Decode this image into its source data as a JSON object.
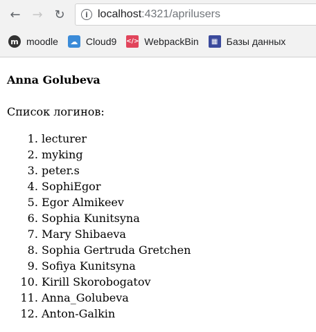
{
  "browser": {
    "url_host": "localhost",
    "url_rest": ":4321/aprilusers",
    "bookmarks": [
      {
        "label": "moodle",
        "icon": "moodle-icon"
      },
      {
        "label": "Cloud9",
        "icon": "cloud9-icon"
      },
      {
        "label": "WebpackBin",
        "icon": "webpackbin-icon"
      },
      {
        "label": "Базы данных",
        "icon": "database-icon"
      }
    ]
  },
  "page": {
    "author": "Anna Golubeva",
    "caption": "Список логинов:",
    "logins": [
      "lecturer",
      "myking",
      "peter.s",
      "SophiEgor",
      "Egor Almikeev",
      "Sophia Kunitsyna",
      "Mary Shibaeva",
      "Sophia Gertruda Gretchen",
      "Sofiya Kunitsyna",
      "Kirill Skorobogatov",
      "Anna_Golubeva",
      "Anton-Galkin"
    ]
  }
}
